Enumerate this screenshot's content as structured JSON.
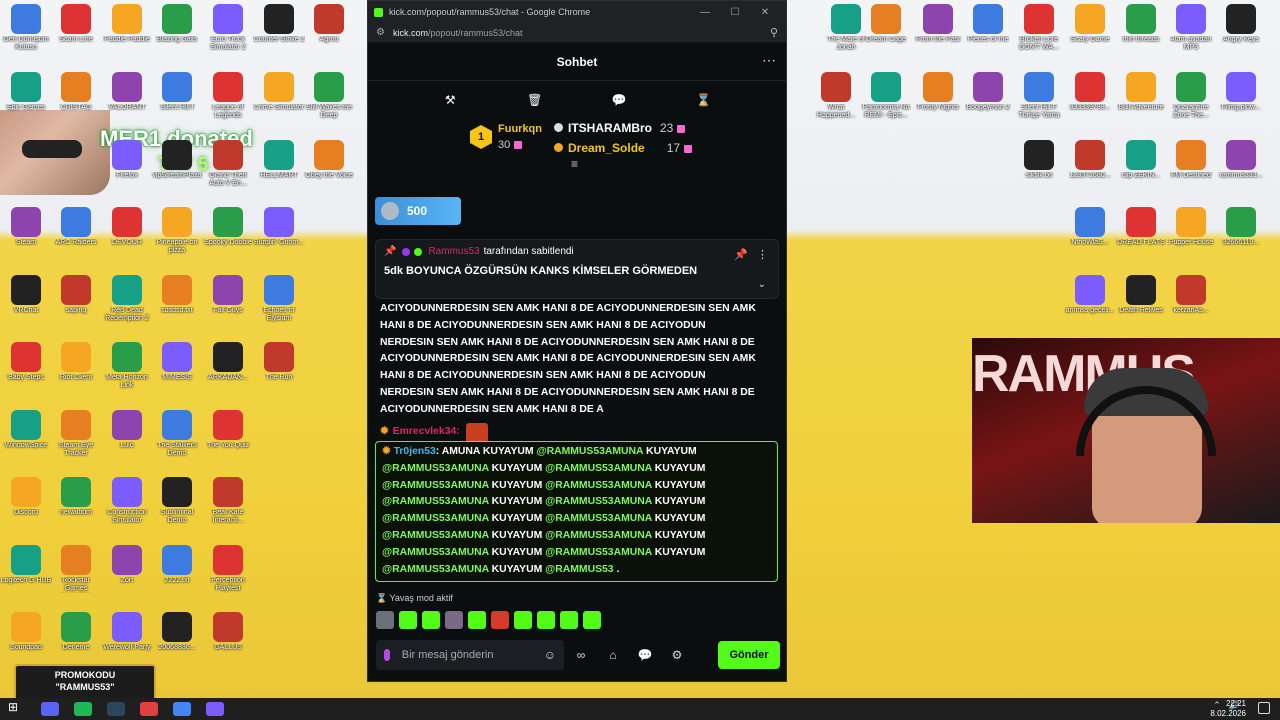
{
  "window": {
    "title": "kick.com/popout/rammus53/chat - Google Chrome",
    "url_host": "kick.com",
    "url_path": "/popout/rammus53/chat"
  },
  "chat": {
    "header_title": "Sohbet",
    "leaderboard": {
      "top_name": "Fuurkqn",
      "top_rank": "1",
      "top_count": "30",
      "second_name": "ITSHARAMBro",
      "second_count": "23",
      "third_name": "Dream_Solde",
      "third_count": "17"
    },
    "pinned_pill_value": "500",
    "pinned": {
      "by_user": "Rammus53",
      "by_text": "tarafından sabitlendi",
      "text": "5dk BOYUNCA ÖZGÜRSÜN KANKS KİMSELER GÖRMEDEN"
    },
    "spam_lines": [
      "ACIYODUNNERDESIN SEN AMK HANI 8 DE ACIYODUNNERDESIN SEN AMK",
      "HANI 8 DE ACIYODUNNERDESIN SEN AMK HANI 8 DE ACIYODUN",
      "NERDESIN SEN AMK HANI 8 DE ACIYODUNNERDESIN SEN AMK HANI 8 DE",
      "ACIYODUNNERDESIN SEN AMK HANI 8 DE ACIYODUNNERDESIN SEN AMK",
      "HANI 8 DE ACIYODUNNERDESIN SEN AMK HANI 8 DE ACIYODUN",
      "NERDESIN SEN AMK HANI 8 DE ACIYODUNNERDESIN SEN AMK HANI 8 DE",
      "ACIYODUNNERDESIN SEN AMK HANI 8 DE A"
    ],
    "msg2_user": "Emrecvlek34:",
    "highlight": {
      "user": "Tr0jen53",
      "first_text": ": AMUNA KUYAYUM ",
      "mention": "@RAMMUS53AMUNA",
      "word": " KUYAYUM ",
      "last_mention": "@RAMMUS53",
      "end": " ."
    },
    "slow_mode": "Yavaş mod aktif",
    "input_placeholder": "Bir mesaj gönderin",
    "send_label": "Gönder"
  },
  "overlay": {
    "donation": "MER1 donated",
    "donation_amount": "TRY 5",
    "promo_title": "PROMOKODU",
    "promo_code": "\"RAMMUS53\"",
    "webcam_brand": "RAMMUS"
  },
  "desktop_icons": [
    "Geri Dönüşüm Kutusu",
    "Scam Line",
    "Paddle Paddle",
    "Blazing Sails",
    "Euro Truck Simulator 2",
    "Counter-Strike 2",
    "Agrou",
    "Epic Games",
    "CRISTAG",
    "VALORANT",
    "Silent Hill f",
    "League of Legends",
    "Crime Simulator",
    "Still Wakes the Deep",
    "Firefox",
    "vlpStreamPlaza",
    "Grand Theft Auto V En...",
    "HELLMART",
    "Obey the Voice",
    "Steam",
    "ARC Raiders",
    "DEVOUR",
    "Pineapple on pizza",
    "Spooky Doobie",
    "Burglin' Gnom...",
    "VRChat",
    "saping",
    "Red Dead Redemption 2",
    "sdsdsd.txt",
    "Fall Guys",
    "Echoes of Elysium",
    "Baby Steps",
    "Riot Client",
    "Meta Horizon Link",
    "MIMESIS",
    "ARKADAN...",
    "The Run",
    "WindowSpice",
    "Steam Eye Tracker",
    "Lulo",
    "The Stalker5 Demo",
    "The You Quiz",
    "Discord",
    "newalbum",
    "Construction Simulator",
    "Subliminal Demo",
    "Beat Kafe Interacti...",
    "Logitech G HUB",
    "Rockstar Games Launcher",
    "Zort",
    "2222.txt",
    "Perception Playtest",
    "Soundpad",
    "Deneme",
    "Werewolf Party",
    "20068836...",
    "GALLUS",
    "The Mare of Jonah",
    "Dream Cage",
    "From the Past",
    "Pieces of me",
    "Broken Lore DON'T WA...",
    "Scary Game",
    "thin threads",
    "4tam avadan MP3",
    "Angry Keys",
    "What Happened...",
    "Paranormia No REMI - Epis...",
    "Frosty Nights",
    "Boogeyman 2",
    "Silent Hill F Türkçe Yama",
    "333339798...",
    "Bull Adventure",
    "Quarantine Zone The...",
    "Filmg plow...",
    "siktilk.txt",
    "123371680...",
    "clip 2EKIN...",
    "FM Destined",
    "rammus333...",
    "NtnoWlaS...",
    "DREAD FLATS",
    "Puppet House",
    "32666119...",
    "annnss geceli...",
    "Death Relives",
    "kerzanAs..."
  ],
  "taskbar": {
    "time": "22:21",
    "date": "8.02.2026"
  }
}
